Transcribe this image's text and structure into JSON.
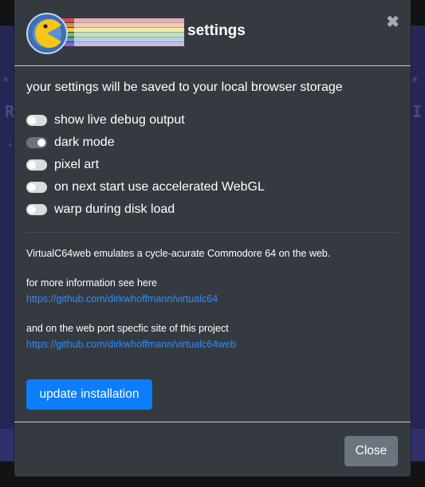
{
  "header": {
    "title": "settings",
    "close_icon": "close-icon",
    "logo": "virtualc64-logo"
  },
  "body": {
    "intro": "your settings will be saved to your local browser storage",
    "switches": [
      {
        "label": "show live debug output",
        "checked": false
      },
      {
        "label": "dark mode",
        "checked": true
      },
      {
        "label": "pixel art",
        "checked": false
      },
      {
        "label": "on next start use accelerated WebGL",
        "checked": false
      },
      {
        "label": "warp during disk load",
        "checked": false
      }
    ],
    "about": "VirtualC64web emulates a cycle-acurate Commodore 64 on the web.",
    "more_info": "for more information see here",
    "link1": "https://github.com/dirkwhoffmann/virtualc64",
    "web_port": "and on the web port specfic site of this project",
    "link2": "https://github.com/dirkwhoffmann/virtualc64web",
    "update_button": "update installation"
  },
  "footer": {
    "close_button": "Close"
  },
  "colors": {
    "modal_bg": "#343a40",
    "primary": "#0d7dfb",
    "secondary": "#6c757d",
    "link": "#2f8cff"
  }
}
